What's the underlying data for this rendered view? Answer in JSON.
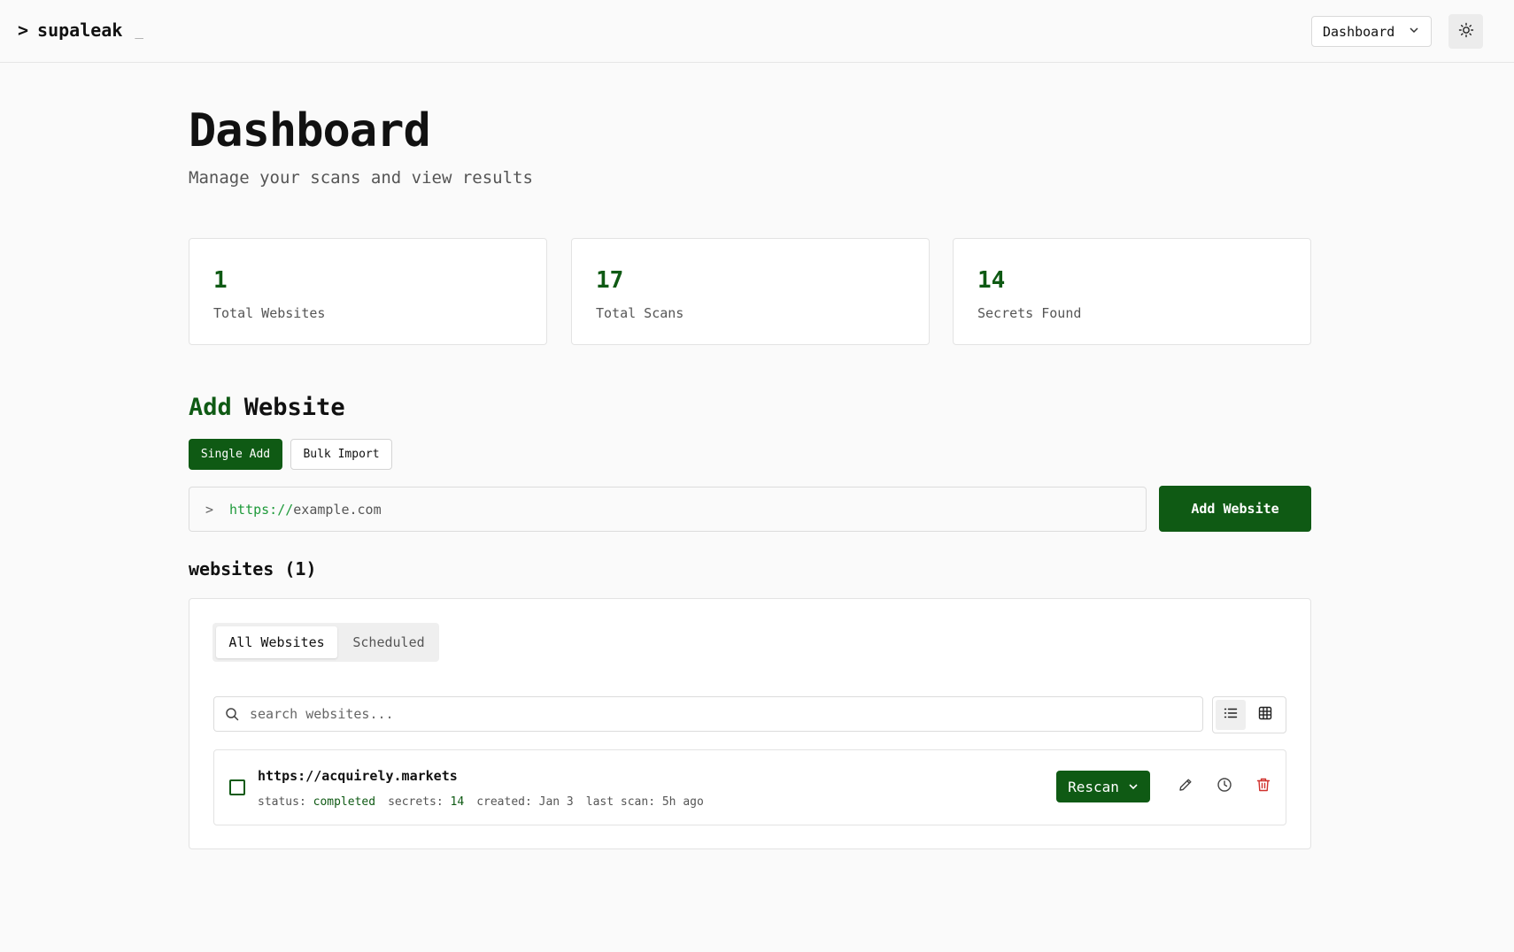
{
  "header": {
    "brand_prompt": ">",
    "brand_name": "supaleak",
    "brand_cursor": "_",
    "nav_selected": "Dashboard"
  },
  "page": {
    "title": "Dashboard",
    "subtitle": "Manage your scans and view results"
  },
  "stats": [
    {
      "value": "1",
      "label": "Total Websites"
    },
    {
      "value": "17",
      "label": "Total Scans"
    },
    {
      "value": "14",
      "label": "Secrets Found"
    }
  ],
  "add_website": {
    "title_accent": "Add",
    "title_rest": "Website",
    "modes": [
      {
        "label": "Single Add",
        "active": true
      },
      {
        "label": "Bulk Import",
        "active": false
      }
    ],
    "input_prompt": ">",
    "input_protocol": "https://",
    "input_placeholder_host": "example.com",
    "submit_label": "Add Website"
  },
  "websites": {
    "title": "websites (1)",
    "tabs": [
      {
        "label": "All Websites",
        "selected": true
      },
      {
        "label": "Scheduled",
        "selected": false
      }
    ],
    "search_placeholder": "search websites...",
    "items": [
      {
        "url": "https://acquirely.markets",
        "status_label": "status:",
        "status": "completed",
        "secrets_label": "secrets:",
        "secrets": "14",
        "created": "created: Jan 3",
        "last_scan": "last scan: 5h ago",
        "action_label": "Rescan"
      }
    ]
  },
  "colors": {
    "accent": "#0f5a14",
    "protocol": "#1e9a3a",
    "danger": "#d0312d"
  }
}
